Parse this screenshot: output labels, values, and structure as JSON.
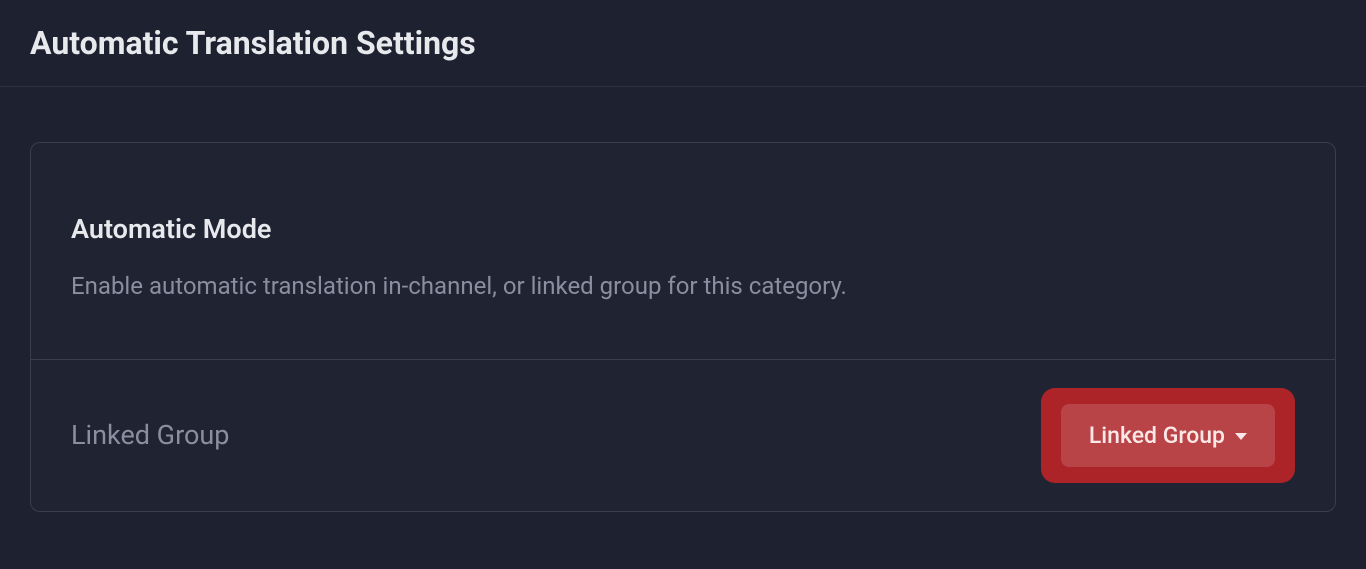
{
  "header": {
    "title": "Automatic Translation Settings"
  },
  "card": {
    "section_title": "Automatic Mode",
    "section_description": "Enable automatic translation in-channel, or linked group for this category.",
    "field_label": "Linked Group",
    "dropdown_selected": "Linked Group"
  }
}
